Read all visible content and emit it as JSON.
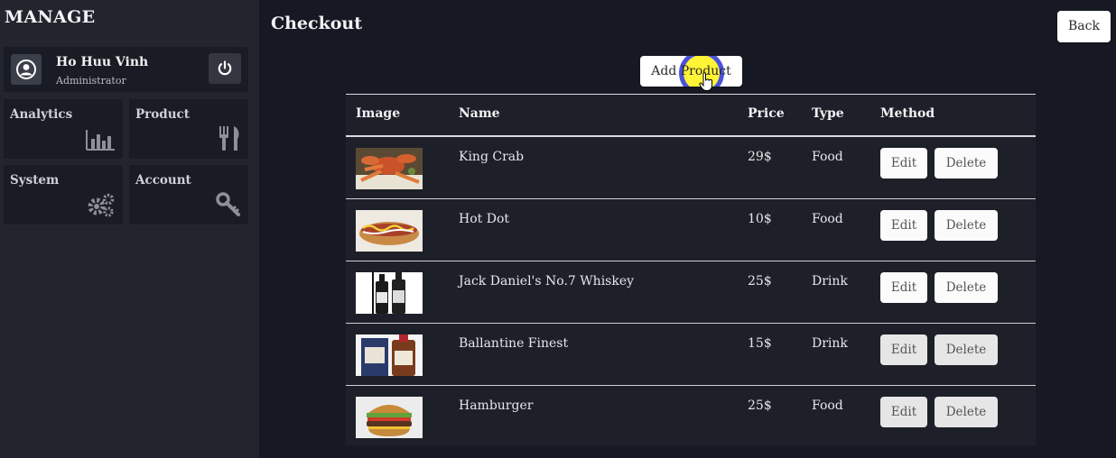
{
  "sidebar": {
    "brand": "MANAGE",
    "user": {
      "name": "Ho Huu Vinh",
      "role": "Administrator"
    },
    "tiles": [
      {
        "label": "Analytics",
        "icon": "bar-chart-icon"
      },
      {
        "label": "Product",
        "icon": "fork-knife-icon"
      },
      {
        "label": "System",
        "icon": "gears-icon"
      },
      {
        "label": "Account",
        "icon": "key-icon"
      }
    ]
  },
  "main": {
    "title": "Checkout",
    "back_label": "Back",
    "add_label": "Add Product"
  },
  "table": {
    "headers": {
      "image": "Image",
      "name": "Name",
      "price": "Price",
      "type": "Type",
      "method": "Method"
    },
    "edit_label": "Edit",
    "delete_label": "Delete",
    "rows": [
      {
        "name": "King Crab",
        "price": "29$",
        "type": "Food",
        "image": "king-crab-photo"
      },
      {
        "name": "Hot Dot",
        "price": "10$",
        "type": "Food",
        "image": "hot-dog-photo"
      },
      {
        "name": "Jack Daniel's No.7 Whiskey",
        "price": "25$",
        "type": "Drink",
        "image": "whiskey-bottle-photo"
      },
      {
        "name": "Ballantine Finest",
        "price": "15$",
        "type": "Drink",
        "image": "ballantine-bottle-photo"
      },
      {
        "name": "Hamburger",
        "price": "25$",
        "type": "Food",
        "image": "hamburger-photo"
      }
    ]
  },
  "colors": {
    "sidebar_bg": "#22252e",
    "main_bg": "#161923",
    "tile_bg": "#191c24",
    "table_bg": "#1e2029",
    "cursor_highlight": "#fff212"
  }
}
